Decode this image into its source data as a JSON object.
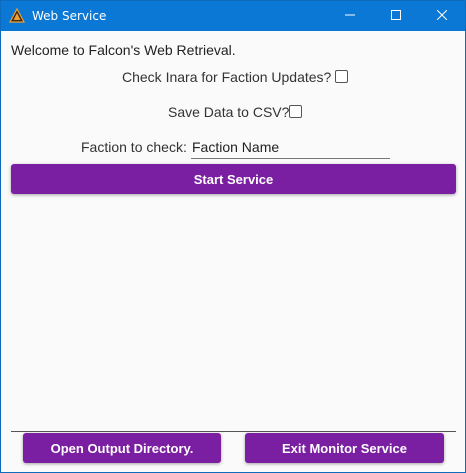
{
  "window": {
    "title": "Web Service",
    "app_icon": "falcon-logo-icon",
    "controls": {
      "minimize_icon": "minimize-icon",
      "maximize_icon": "maximize-icon",
      "close_icon": "close-icon"
    }
  },
  "main": {
    "welcome_text": "Welcome to Falcon's Web Retrieval.",
    "inara_check": {
      "label": "Check Inara for Faction Updates?",
      "checked": false
    },
    "csv_check": {
      "label": "Save Data to CSV?",
      "checked": false
    },
    "faction": {
      "label": "Faction to check:",
      "value": "Faction Name"
    },
    "start_button": "Start Service"
  },
  "footer": {
    "open_output_button": "Open Output Directory.",
    "exit_monitor_button": "Exit Monitor Service"
  },
  "colors": {
    "titlebar": "#0a78d4",
    "accent_button": "#7b1fa2",
    "background": "#fafafa"
  }
}
